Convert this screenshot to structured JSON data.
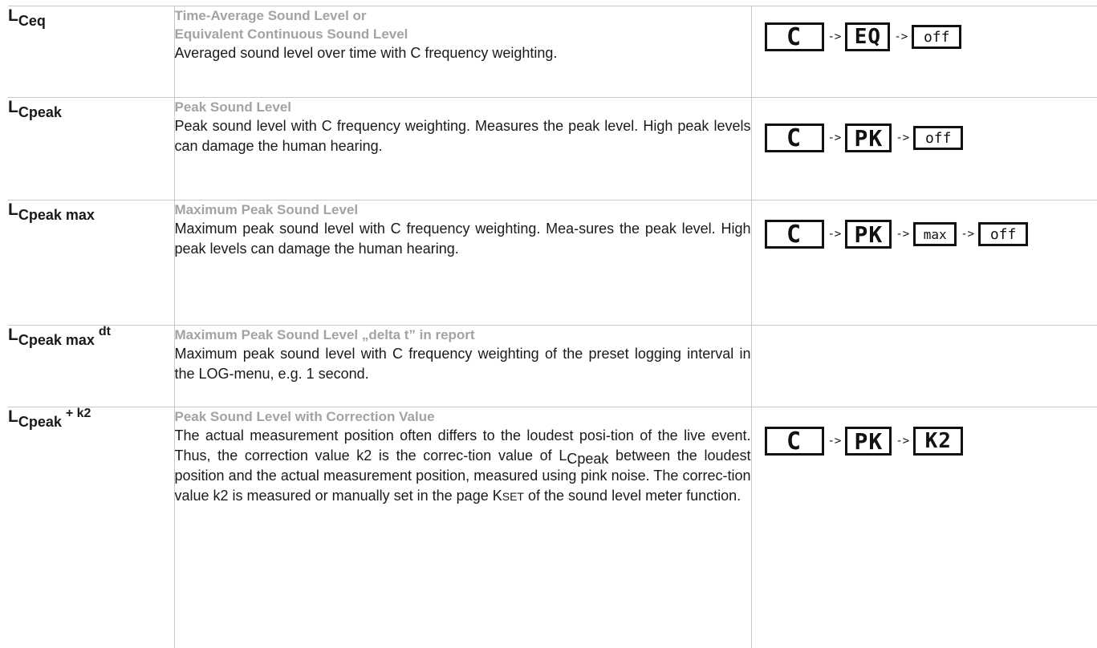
{
  "rows": [
    {
      "symbol": {
        "l": "L",
        "sub": "Ceq",
        "sup": ""
      },
      "heading_lines": [
        "Time-Average Sound Level or",
        "Equivalent Continuous Sound Level"
      ],
      "text": "Averaged sound level over time with C frequency weighting.",
      "sequence": [
        "C",
        "EQ",
        "off"
      ]
    },
    {
      "symbol": {
        "l": "L",
        "sub": "Cpeak",
        "sup": ""
      },
      "heading_lines": [
        "Peak Sound Level"
      ],
      "text": "Peak sound level with C frequency weighting. Measures the peak level. High peak levels can damage the human hearing.",
      "sequence": [
        "C",
        "PK",
        "off"
      ]
    },
    {
      "symbol": {
        "l": "L",
        "sub": "Cpeak max",
        "sup": ""
      },
      "heading_lines": [
        "Maximum Peak Sound Level"
      ],
      "text": "Maximum peak sound level with C frequency weighting. Mea-sures the peak level. High peak levels can damage the human hearing.",
      "sequence": [
        "C",
        "PK",
        "max",
        "off"
      ]
    },
    {
      "symbol": {
        "l": "L",
        "sub": "Cpeak max",
        "sup": "dt"
      },
      "heading_lines": [
        "Maximum Peak Sound Level „delta t” in report"
      ],
      "text": "Maximum peak sound level with C frequency weighting of the preset logging interval in the LOG-menu, e.g. 1 second.",
      "sequence": []
    },
    {
      "symbol": {
        "l": "L",
        "sub": "Cpeak",
        "sup": "+ k2"
      },
      "heading_lines": [
        "Peak Sound Level with Correction Value"
      ],
      "text_parts": {
        "before": "The actual measurement position often differs to the loudest posi-tion of the live event. Thus, the correction value k2 is the correc-tion value of ",
        "inline_l": "L",
        "inline_sub": "Cpeak",
        "middle": " between the loudest position and the actual measurement position, measured using pink noise. The correc-tion value k2 is measured or manually set in the page ",
        "kset_k": "K",
        "kset_rest": "SET",
        "after": " of the sound level meter function."
      },
      "sequence": [
        "C",
        "PK",
        "K2"
      ]
    }
  ],
  "arrow_glyph": "->"
}
